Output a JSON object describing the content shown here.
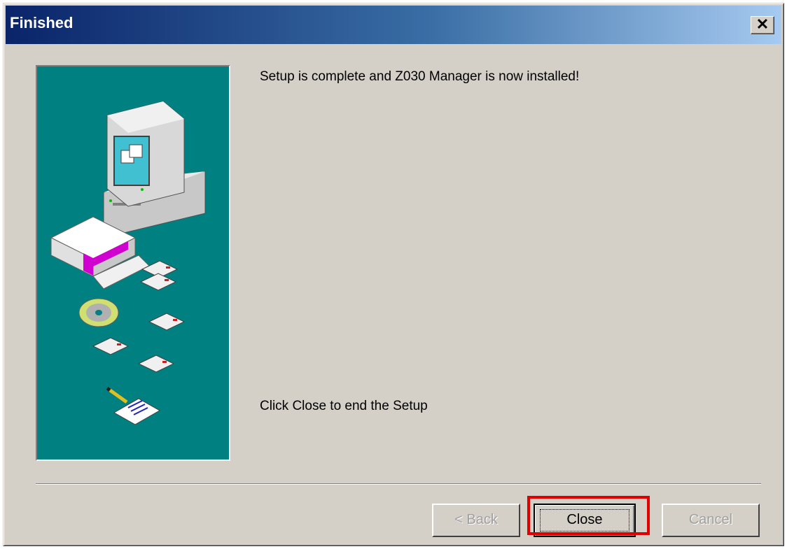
{
  "window": {
    "title": "Finished"
  },
  "messages": {
    "complete": "Setup is complete and Z030 Manager is now installed!",
    "instruction": "Click Close to end the Setup"
  },
  "buttons": {
    "back": "< Back",
    "close": "Close",
    "cancel": "Cancel"
  },
  "colors": {
    "title_start": "#0a246a",
    "title_end": "#a6caf0",
    "dialog_face": "#d4d0c8",
    "art_background": "#008080",
    "highlight": "#e00000"
  },
  "icons": [
    "close-icon",
    "computer-icon",
    "software-box-icon",
    "cd-icon",
    "floppy-disk-icon",
    "document-pen-icon"
  ]
}
